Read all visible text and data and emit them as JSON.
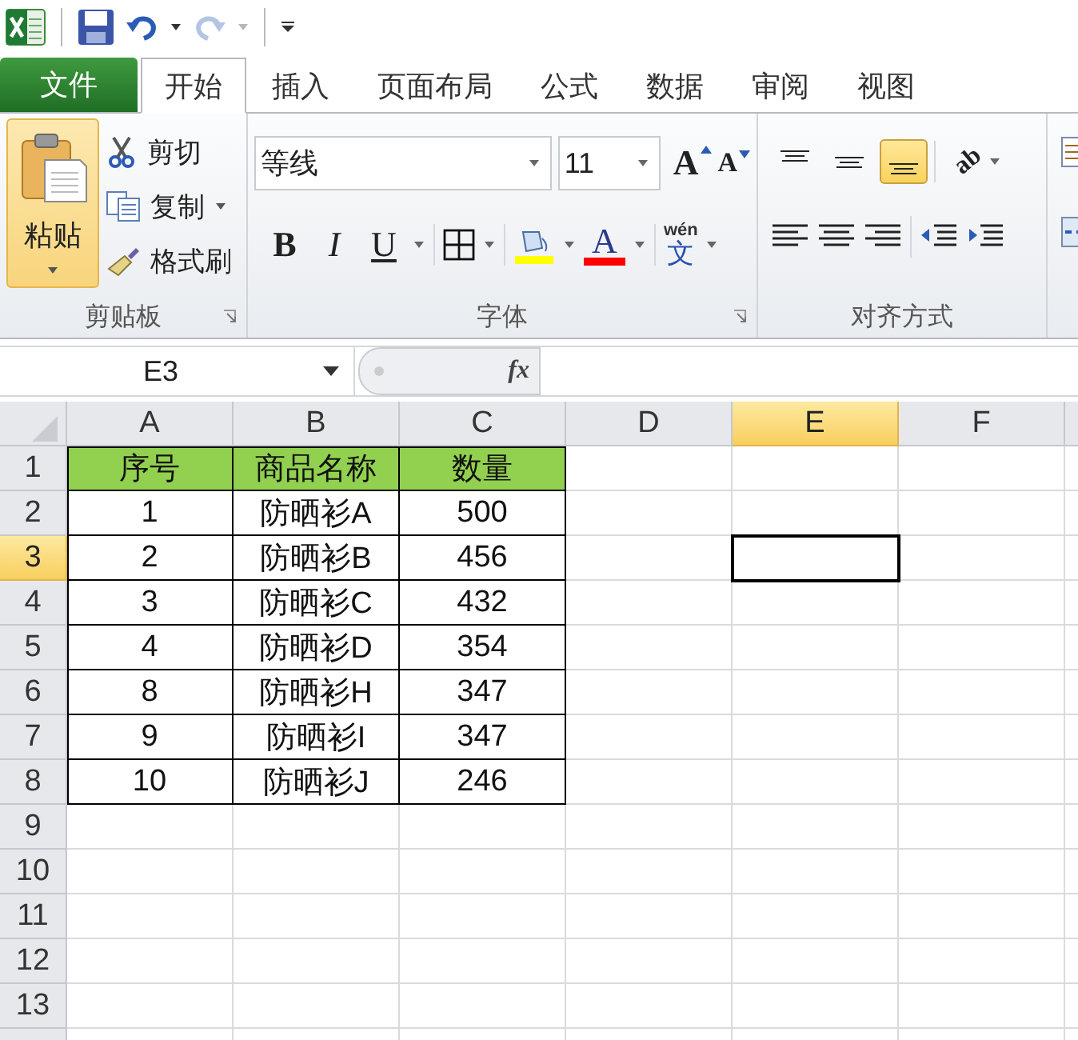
{
  "quick_access_toolbar": {
    "redo": {
      "disabled": true
    }
  },
  "menu_tabs": [
    {
      "label": "文件",
      "kind": "file",
      "selected": false
    },
    {
      "label": "开始",
      "kind": "tab",
      "selected": true
    },
    {
      "label": "插入",
      "kind": "tab",
      "selected": false
    },
    {
      "label": "页面布局",
      "kind": "tab",
      "selected": false
    },
    {
      "label": "公式",
      "kind": "tab",
      "selected": false
    },
    {
      "label": "数据",
      "kind": "tab",
      "selected": false
    },
    {
      "label": "审阅",
      "kind": "tab",
      "selected": false
    },
    {
      "label": "视图",
      "kind": "tab",
      "selected": false
    }
  ],
  "ribbon": {
    "clipboard": {
      "paste": "粘贴",
      "cut": "剪切",
      "copy": "复制",
      "format_painter": "格式刷",
      "title": "剪贴板"
    },
    "font": {
      "font_name": "等线",
      "font_size": "11",
      "grow": "A",
      "shrink": "A",
      "bold": "B",
      "italic": "I",
      "underline": "U",
      "font_color": "A",
      "phonetic_top": "wén",
      "phonetic": "文",
      "title": "字体"
    },
    "alignment": {
      "vertical": [
        {
          "kind": "top",
          "selected": false
        },
        {
          "kind": "middle",
          "selected": false
        },
        {
          "kind": "bottom",
          "selected": true
        }
      ],
      "orientation": "ab",
      "title": "对齐方式"
    }
  },
  "formula_bar": {
    "name_box": "E3",
    "fx": "fx"
  },
  "sheet": {
    "columns": [
      {
        "label": "A",
        "selected": false
      },
      {
        "label": "B",
        "selected": false
      },
      {
        "label": "C",
        "selected": false
      },
      {
        "label": "D",
        "selected": false
      },
      {
        "label": "E",
        "selected": true
      },
      {
        "label": "F",
        "selected": false
      }
    ],
    "rows": [
      {
        "number": "1",
        "kind": "header",
        "selected": false,
        "cells": [
          "序号",
          "商品名称",
          "数量"
        ]
      },
      {
        "number": "2",
        "kind": "data",
        "selected": false,
        "cells": [
          "1",
          "防晒衫A",
          "500"
        ]
      },
      {
        "number": "3",
        "kind": "data",
        "selected": true,
        "cells": [
          "2",
          "防晒衫B",
          "456"
        ]
      },
      {
        "number": "4",
        "kind": "data",
        "selected": false,
        "cells": [
          "3",
          "防晒衫C",
          "432"
        ]
      },
      {
        "number": "5",
        "kind": "data",
        "selected": false,
        "cells": [
          "4",
          "防晒衫D",
          "354"
        ]
      },
      {
        "number": "6",
        "kind": "data",
        "selected": false,
        "cells": [
          "8",
          "防晒衫H",
          "347"
        ]
      },
      {
        "number": "7",
        "kind": "data",
        "selected": false,
        "cells": [
          "9",
          "防晒衫I",
          "347"
        ]
      },
      {
        "number": "8",
        "kind": "data",
        "selected": false,
        "cells": [
          "10",
          "防晒衫J",
          "246"
        ]
      },
      {
        "number": "9",
        "kind": "empty",
        "selected": false,
        "cells": []
      },
      {
        "number": "10",
        "kind": "empty",
        "selected": false,
        "cells": []
      },
      {
        "number": "11",
        "kind": "empty",
        "selected": false,
        "cells": []
      },
      {
        "number": "12",
        "kind": "empty",
        "selected": false,
        "cells": []
      },
      {
        "number": "13",
        "kind": "empty",
        "selected": false,
        "cells": []
      }
    ]
  }
}
